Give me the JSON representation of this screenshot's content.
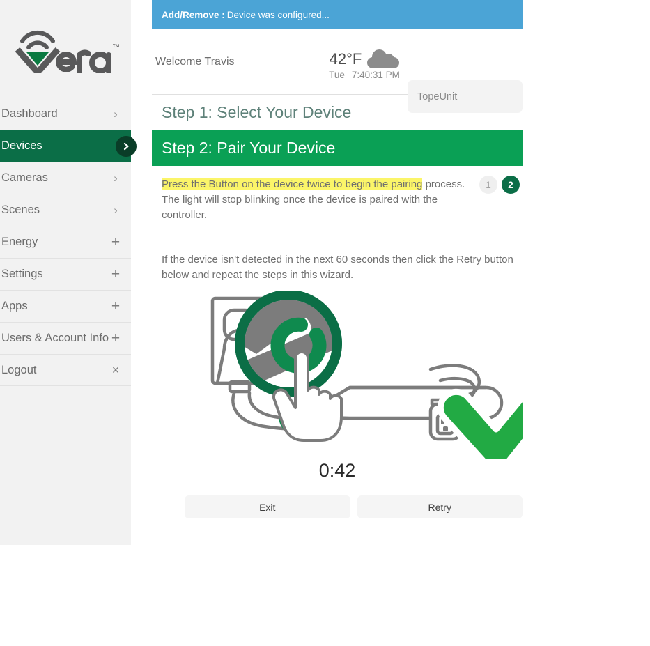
{
  "brand": {
    "logo_text": "vera",
    "trademark": "™"
  },
  "sidebar": {
    "items": [
      {
        "label": "Dashboard",
        "mark": "›",
        "mark_type": "chevron",
        "active": false
      },
      {
        "label": "Devices",
        "mark": "›",
        "mark_type": "badge",
        "active": true
      },
      {
        "label": "Cameras",
        "mark": "›",
        "mark_type": "chevron",
        "active": false
      },
      {
        "label": "Scenes",
        "mark": "›",
        "mark_type": "chevron",
        "active": false
      },
      {
        "label": "Energy",
        "mark": "+",
        "mark_type": "plus",
        "active": false
      },
      {
        "label": "Settings",
        "mark": "+",
        "mark_type": "plus",
        "active": false
      },
      {
        "label": "Apps",
        "mark": "+",
        "mark_type": "plus",
        "active": false
      },
      {
        "label": "Users & Account Info",
        "mark": "+",
        "mark_type": "plus",
        "active": false
      },
      {
        "label": "Logout",
        "mark": "×",
        "mark_type": "close",
        "active": false
      }
    ]
  },
  "banner": {
    "title": "Add/Remove :",
    "message": "Device was configured..."
  },
  "header": {
    "welcome": "Welcome Travis",
    "temperature": "42°F",
    "weather_icon": "cloud-icon",
    "day": "Tue",
    "time": "7:40:31 PM",
    "unit_name": "TopeUnit"
  },
  "wizard": {
    "step1_title": "Step 1: Select Your Device",
    "step2_title": "Step 2: Pair Your Device",
    "instruction_highlighted": "Press the Button on the device twice to begin the pairing",
    "instruction_rest": " process. The light will stop blinking once the device is paired with the controller.",
    "retry_note": "If the device isn't detected in the next 60 seconds then click the Retry button below and repeat the steps in this wizard.",
    "steps": [
      {
        "number": "1",
        "state": "inactive"
      },
      {
        "number": "2",
        "state": "active"
      }
    ],
    "timer": "0:42",
    "exit_label": "Exit",
    "retry_label": "Retry"
  },
  "colors": {
    "sidebar_bg": "#f2f2f2",
    "active_nav": "#0b6e47",
    "step_bar_green": "#0aa055",
    "banner_blue": "#4ba4d6",
    "highlight_yellow": "#fbf569",
    "check_green": "#22aa44",
    "outline_gray": "#7c7c7c"
  }
}
